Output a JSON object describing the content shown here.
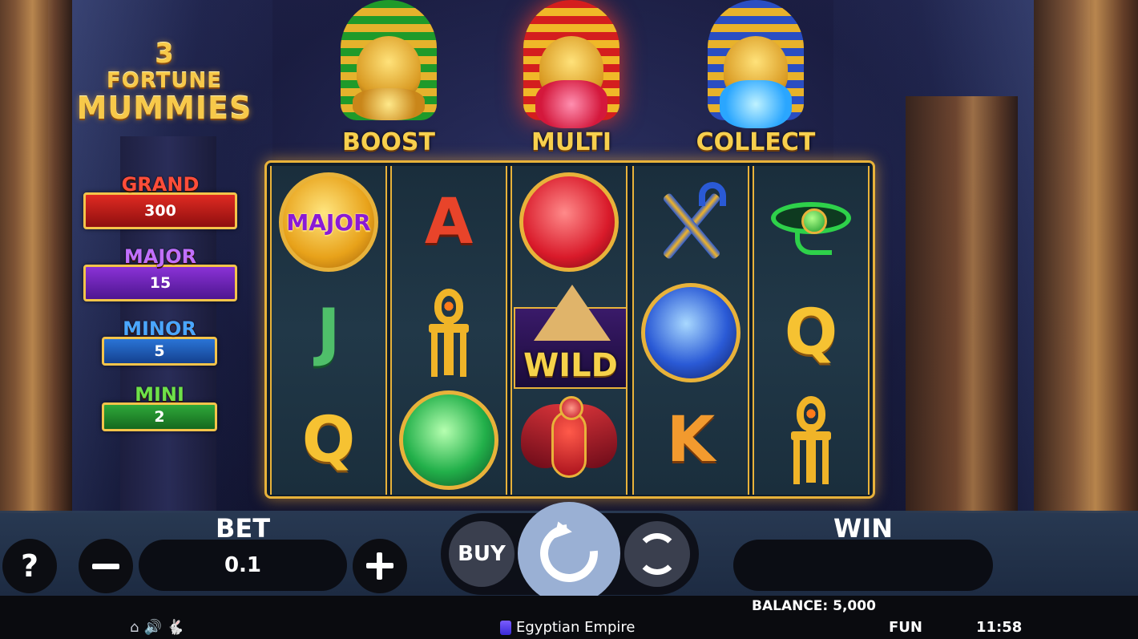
{
  "game": {
    "title_line1": "3",
    "title_line2": "FORTUNE",
    "title_line3": "MUMMIES"
  },
  "mummies": [
    {
      "label": "BOOST",
      "color": "#1f9a2a"
    },
    {
      "label": "MULTI",
      "color": "#d41e1e"
    },
    {
      "label": "COLLECT",
      "color": "#2a4ec2"
    }
  ],
  "jackpots": {
    "grand": {
      "label": "GRAND",
      "value": "300",
      "color": "#e02a22"
    },
    "major": {
      "label": "MAJOR",
      "value": "15",
      "color": "#8a32d6"
    },
    "minor": {
      "label": "MINOR",
      "value": "5",
      "color": "#2a74d6"
    },
    "mini": {
      "label": "MINI",
      "value": "2",
      "color": "#2fa83a"
    }
  },
  "reels": {
    "symbols": [
      [
        "orb-gold-major",
        "letter-J",
        "letter-Q"
      ],
      [
        "letter-A",
        "ankh",
        "orb-green"
      ],
      [
        "orb-red",
        "wild-pyramid",
        "scarab"
      ],
      [
        "crook-and-flail",
        "orb-blue",
        "letter-K"
      ],
      [
        "eye-of-horus",
        "letter-Q",
        "ankh"
      ]
    ],
    "major_orb_label": "MAJOR",
    "wild_label": "WILD",
    "letters": {
      "a": "A",
      "j": "J",
      "q": "Q",
      "k": "K"
    }
  },
  "controls": {
    "help_label": "?",
    "bet_label": "BET",
    "bet_value": "0.1",
    "buy_label": "BUY",
    "win_label": "WIN",
    "win_value": ""
  },
  "footer": {
    "balance": "BALANCE: 5,000",
    "game_name": "Egyptian Empire",
    "mode": "FUN",
    "time": "11:58",
    "icons": [
      "home-icon",
      "sound-icon",
      "turbo-icon"
    ]
  }
}
